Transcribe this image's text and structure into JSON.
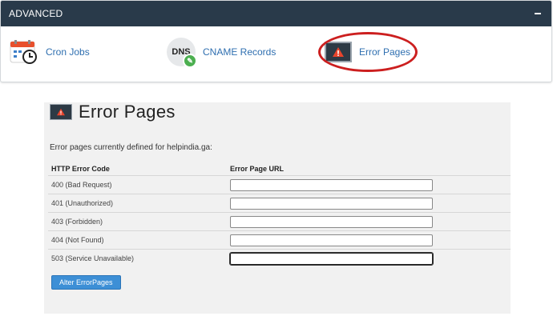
{
  "advanced": {
    "title": "ADVANCED",
    "collapse_symbol": "−",
    "items": [
      {
        "label": "Cron Jobs",
        "icon": "calendar-clock-icon"
      },
      {
        "label": "CNAME Records",
        "icon_text": "DNS",
        "icon": "dns-edit-icon"
      },
      {
        "label": "Error Pages",
        "icon": "warning-icon"
      }
    ]
  },
  "error_pages": {
    "title": "Error Pages",
    "description": "Error pages currently defined for helpindia.ga:",
    "columns": [
      "HTTP Error Code",
      "Error Page URL"
    ],
    "rows": [
      {
        "code": "400 (Bad Request)",
        "url": ""
      },
      {
        "code": "401 (Unauthorized)",
        "url": ""
      },
      {
        "code": "403 (Forbidden)",
        "url": ""
      },
      {
        "code": "404 (Not Found)",
        "url": ""
      },
      {
        "code": "503 (Service Unavailable)",
        "url": ""
      }
    ],
    "button_label": "Alter ErrorPages"
  },
  "colors": {
    "header_bg": "#293a4a",
    "link": "#2f6fb0",
    "highlight_oval": "#cc1f1f",
    "button_bg": "#3d8fd6",
    "warning": "#e8442c"
  }
}
